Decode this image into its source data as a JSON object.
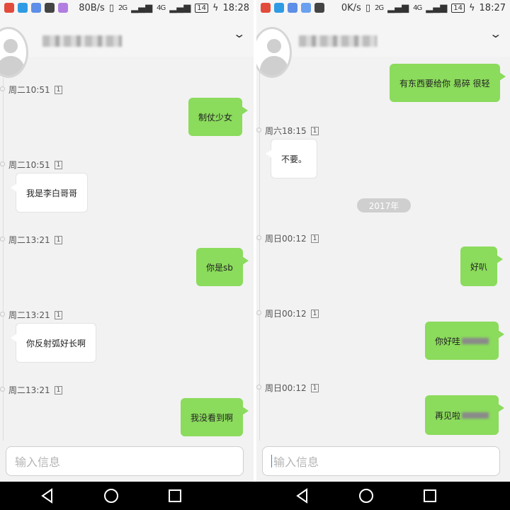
{
  "left": {
    "status": {
      "net_speed": "80B/s",
      "battery": "14",
      "time": "18:28",
      "sig1": "2G",
      "sig2": "4G"
    },
    "messages": [
      {
        "dir": "out",
        "time": "周二10:51",
        "text": "制仗少女"
      },
      {
        "dir": "in",
        "time": "周二10:51",
        "text": "我是李白哥哥"
      },
      {
        "dir": "out",
        "time": "周二13:21",
        "text": "你是sb"
      },
      {
        "dir": "in",
        "time": "周二13:21",
        "text": "你反射弧好长啊"
      },
      {
        "dir": "out",
        "time": "周二13:21",
        "text": "我没看到啊"
      }
    ],
    "input_placeholder": "输入信息"
  },
  "right": {
    "status": {
      "net_speed": "0K/s",
      "battery": "14",
      "time": "18:27",
      "sig1": "2G",
      "sig2": "4G"
    },
    "messages": [
      {
        "dir": "out",
        "time": "",
        "text": "有东西要给你 易碎 很轻"
      },
      {
        "dir": "in",
        "time": "周六18:15",
        "text": "不要。"
      },
      {
        "dir": "out",
        "time": "周日00:12",
        "text": "好叭"
      },
      {
        "dir": "out",
        "time": "周日00:12",
        "text": "你好哇"
      },
      {
        "dir": "out",
        "time": "周日00:12",
        "text": "再见啦"
      }
    ],
    "year_divider": "2017年",
    "input_placeholder": "输入信息"
  },
  "sim_label": "1",
  "colors": {
    "out_bubble": "#8bdb5c",
    "in_bubble": "#ffffff",
    "background": "#f2f2f2"
  },
  "icons": [
    "back-icon",
    "home-icon",
    "recents-icon",
    "chevron-down-icon"
  ]
}
